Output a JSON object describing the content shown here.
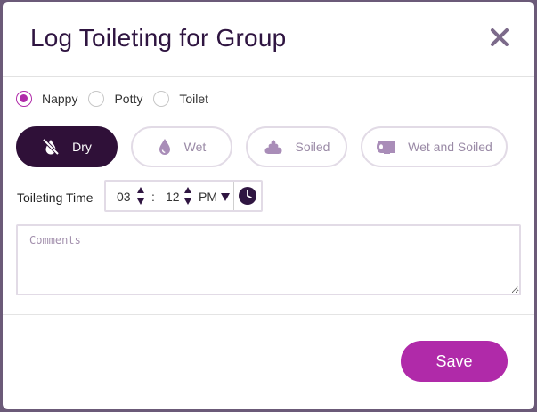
{
  "dialog": {
    "title": "Log Toileting for Group",
    "close_icon": "close-icon"
  },
  "toilet_types": [
    {
      "label": "Nappy",
      "selected": true
    },
    {
      "label": "Potty",
      "selected": false
    },
    {
      "label": "Toilet",
      "selected": false
    }
  ],
  "statuses": [
    {
      "label": "Dry",
      "icon": "no-drop-icon",
      "active": true
    },
    {
      "label": "Wet",
      "icon": "water-drop-icon",
      "active": false
    },
    {
      "label": "Soiled",
      "icon": "poop-icon",
      "active": false
    },
    {
      "label": "Wet and Soiled",
      "icon": "toilet-roll-icon",
      "active": false
    }
  ],
  "time": {
    "label": "Toileting Time",
    "hour": "03",
    "separator": ":",
    "minute": "12",
    "meridiem": "PM",
    "clock_icon": "clock-icon"
  },
  "comments": {
    "placeholder": "Comments",
    "value": ""
  },
  "actions": {
    "save_label": "Save"
  },
  "colors": {
    "primary": "#b02aa9",
    "dark": "#2f1038",
    "title": "#2f1541",
    "pill_border": "#e2dbe6",
    "pill_text": "#9a8aa6"
  }
}
